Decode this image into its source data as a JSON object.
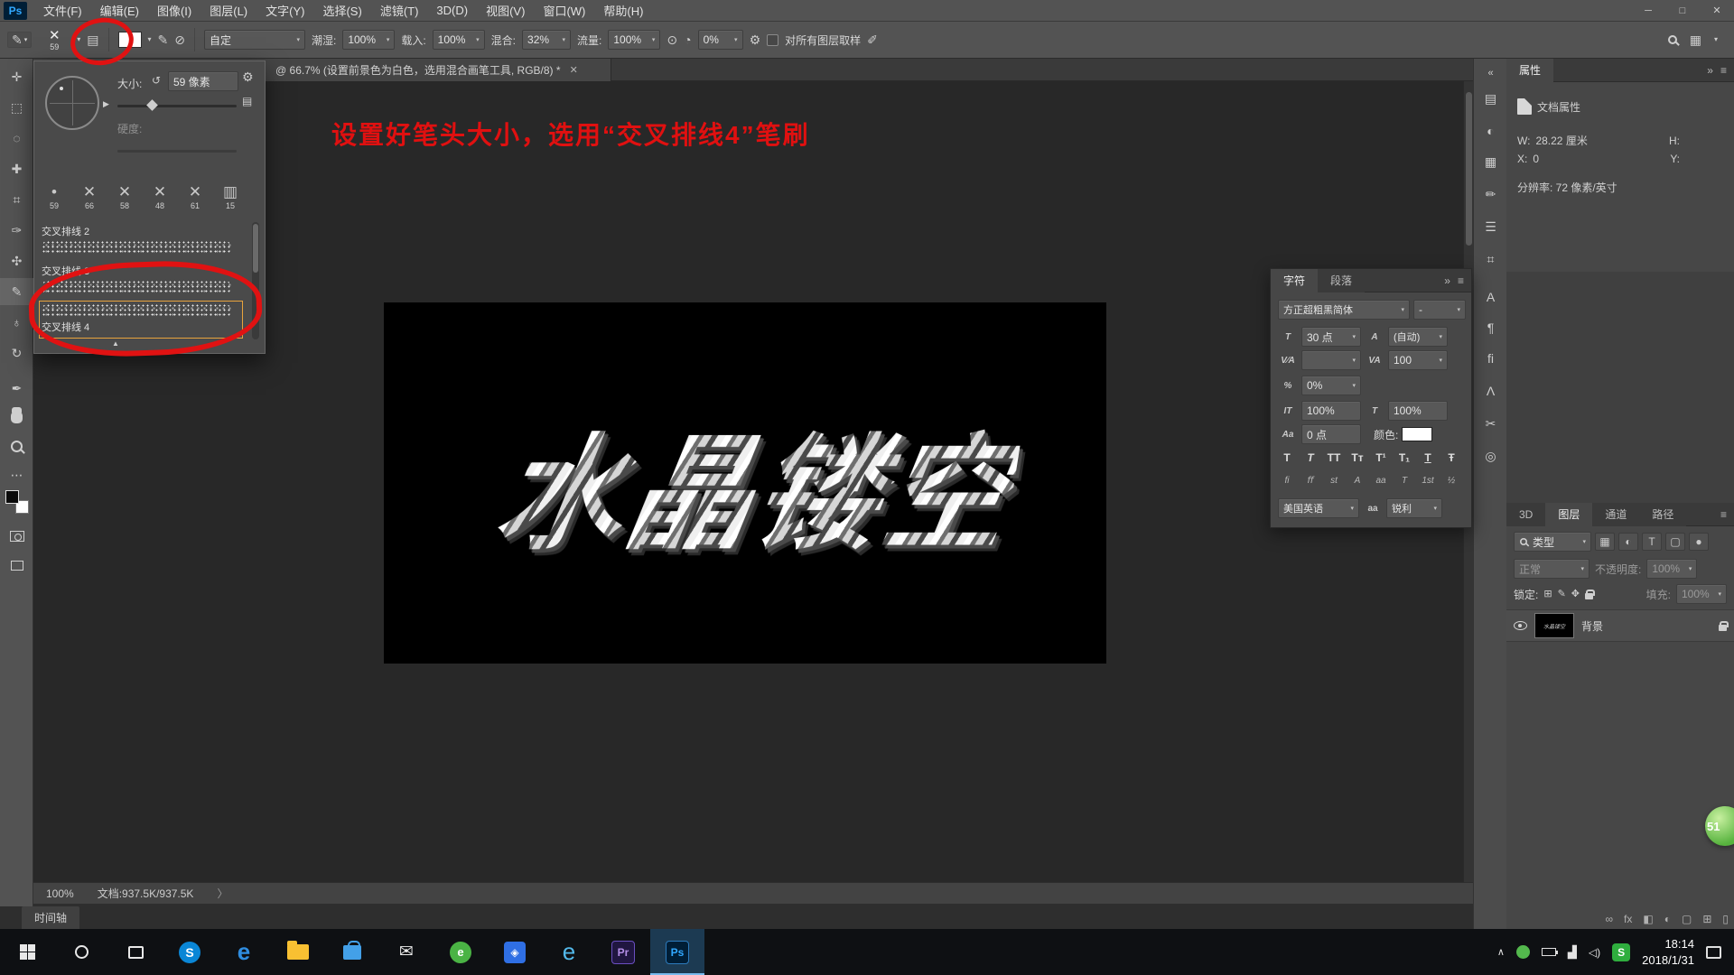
{
  "window": {
    "logo": "Ps",
    "minimize": "─",
    "maximize": "□",
    "close": "✕"
  },
  "menu_bar": {
    "items": [
      "文件(F)",
      "编辑(E)",
      "图像(I)",
      "图层(L)",
      "文字(Y)",
      "选择(S)",
      "滤镜(T)",
      "3D(D)",
      "视图(V)",
      "窗口(W)",
      "帮助(H)"
    ]
  },
  "options_bar": {
    "brush_glyph": "✕",
    "brush_size": "59",
    "preset": "自定",
    "fields": [
      {
        "label": "潮湿:",
        "value": "100%"
      },
      {
        "label": "载入:",
        "value": "100%"
      },
      {
        "label": "混合:",
        "value": "32%"
      },
      {
        "label": "流量:",
        "value": "100%"
      }
    ],
    "smooth_value": "0%",
    "sample_all": "对所有图层取样"
  },
  "brush_popup": {
    "size_label": "大小:",
    "size_value": "59 像素",
    "hardness_label": "硬度:",
    "tips": [
      {
        "glyph": "•",
        "num": "59"
      },
      {
        "glyph": "✕",
        "num": "66"
      },
      {
        "glyph": "✕",
        "num": "58"
      },
      {
        "glyph": "✕",
        "num": "48"
      },
      {
        "glyph": "✕",
        "num": "61"
      },
      {
        "glyph": "▥",
        "num": "15"
      }
    ],
    "brushes": [
      "交叉排线 2",
      "交叉排线 3",
      "交叉排线 4"
    ]
  },
  "annotation": "设置好笔头大小，选用“交叉排线4”笔刷",
  "doc": {
    "tab": "@ 66.7% (设置前景色为白色，选用混合画笔工具, RGB/8) *",
    "canvas_text": "水晶镂空",
    "zoom": "100%",
    "size_info": "文档:937.5K/937.5K"
  },
  "timeline_label": "时间轴",
  "props": {
    "tab": "属性",
    "section": "文档属性",
    "w_label": "W:",
    "w_value": "28.22 厘米",
    "h_label": "H:",
    "x_label": "X:",
    "x_value": "0",
    "y_label": "Y:",
    "resolution": "分辨率: 72 像素/英寸"
  },
  "char": {
    "tab1": "字符",
    "tab2": "段落",
    "font": "方正超粗黑简体",
    "style": "-",
    "size_icon": "T",
    "size": "30 点",
    "leading_icon": "A",
    "leading": "(自动)",
    "kern_icon": "V∕A",
    "kern": "",
    "track_icon": "VA",
    "track": "100",
    "ratio_icon": "%",
    "ratio": "0%",
    "vscale_icon": "IT",
    "vscale": "100%",
    "hscale_icon": "T",
    "hscale": "100%",
    "baseline_icon": "Aa",
    "baseline": "0 点",
    "color_label": "颜色:",
    "styles": [
      "T",
      "T",
      "TT",
      "Tᴛ",
      "T¹",
      "T₁",
      "T",
      "Ŧ"
    ],
    "ot": [
      "fi",
      "ﬀ",
      "st",
      "A",
      "aa",
      "T",
      "1st",
      "½"
    ],
    "lang": "美国英语",
    "aa_label": "aa",
    "aa_value": "锐利"
  },
  "layers": {
    "tabs": [
      "3D",
      "图层",
      "通道",
      "路径"
    ],
    "filter": "类型",
    "blend": "正常",
    "opacity_label": "不透明度:",
    "opacity": "100%",
    "lock_label": "锁定:",
    "fill_label": "填充:",
    "fill": "100%",
    "layer_name": "背景",
    "fx": "fx"
  },
  "taskbar": {
    "time": "18:14",
    "date": "2018/1/31",
    "apps": [
      {
        "name": "skype",
        "glyph": "S"
      },
      {
        "name": "edge",
        "glyph": "e"
      },
      {
        "name": "file-explorer",
        "glyph": ""
      },
      {
        "name": "store",
        "glyph": ""
      },
      {
        "name": "mail",
        "glyph": "✉"
      },
      {
        "name": "browser-green",
        "glyph": ""
      },
      {
        "name": "photo-app",
        "glyph": "◈"
      },
      {
        "name": "ie",
        "glyph": "e"
      },
      {
        "name": "premiere",
        "glyph": "Pr"
      },
      {
        "name": "photoshop",
        "glyph": "Ps"
      }
    ]
  },
  "widget": "51",
  "glyphs": {
    "gear": "⚙",
    "reset": "↺",
    "menu": "≡",
    "collapse": "»",
    "expand": "«",
    "chevron": "〉",
    "dropdown": "▾",
    "play": "▶",
    "handle": "▲",
    "airbrush": "⊙",
    "smooth": "◔",
    "panel_toggle": "▤",
    "dots": "⋯",
    "strip1": [
      "▤",
      "◐",
      "▦",
      "✏",
      "☰",
      "⌗"
    ],
    "strip2": [
      "A",
      "¶",
      "ﬁ",
      "Λ",
      "✂",
      "◎"
    ],
    "lock_row": [
      "⊞",
      "✎",
      "✥"
    ],
    "filter_btns": [
      "▦",
      "◐",
      "T",
      "▢",
      "●"
    ],
    "bottom_btns": [
      "∞",
      "fx",
      "◧",
      "◐",
      "▢",
      "⊞",
      "▯"
    ],
    "tools": [
      "✛",
      "⬚",
      "◌",
      "✚",
      "⌗",
      "✑",
      "✣",
      "✎",
      "♁",
      "↻",
      "✒"
    ]
  }
}
